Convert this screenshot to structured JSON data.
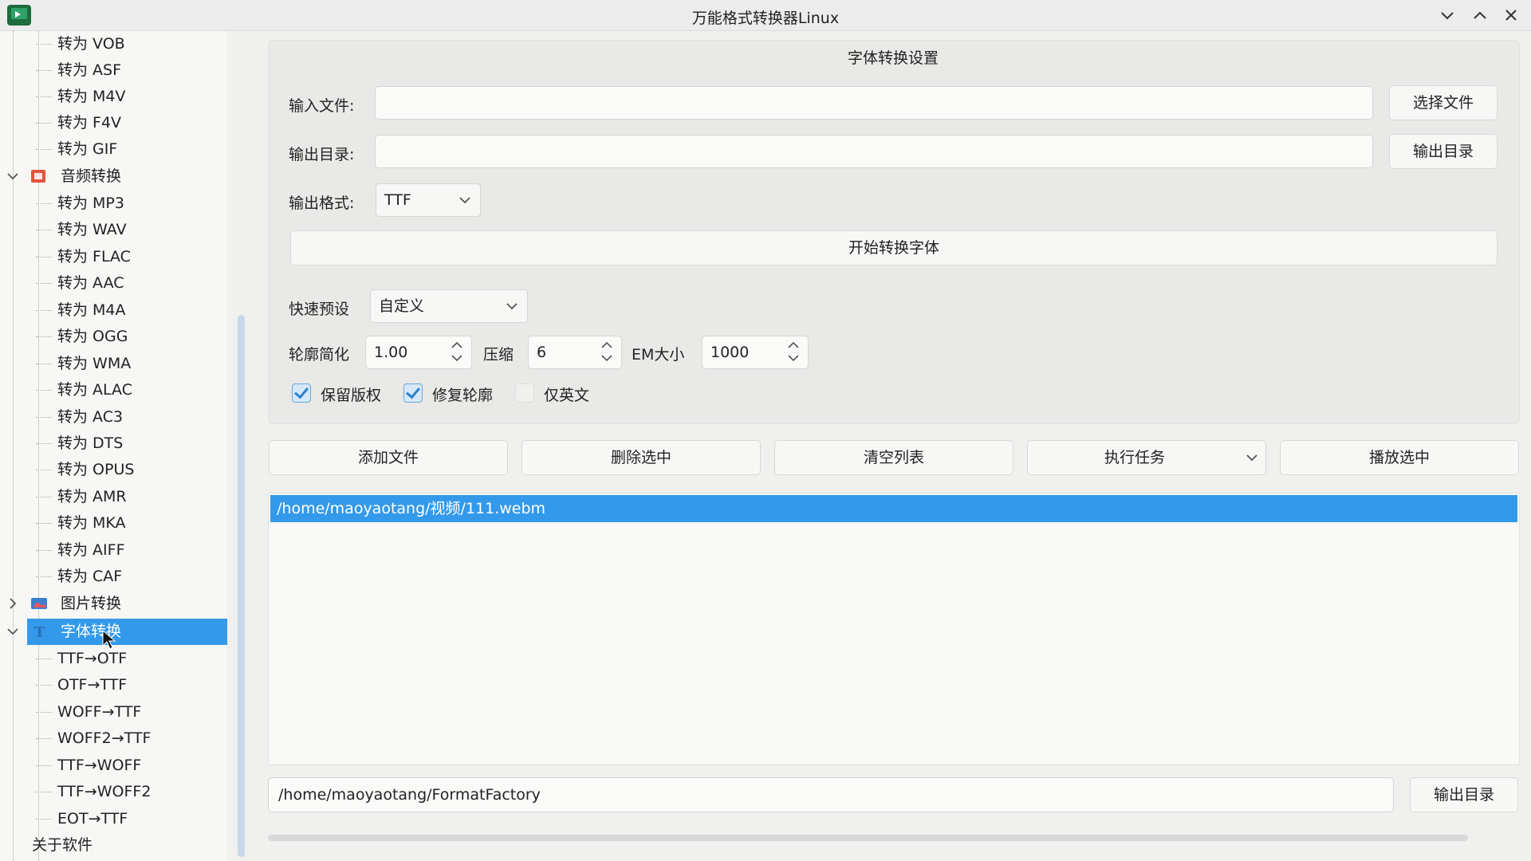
{
  "window": {
    "title": "万能格式转换器Linux"
  },
  "sidebar": {
    "video_children": [
      "转为 VOB",
      "转为 ASF",
      "转为 M4V",
      "转为 F4V",
      "转为 GIF"
    ],
    "audio": {
      "label": "音频转换",
      "children": [
        "转为 MP3",
        "转为 WAV",
        "转为 FLAC",
        "转为 AAC",
        "转为 M4A",
        "转为 OGG",
        "转为 WMA",
        "转为 ALAC",
        "转为 AC3",
        "转为 DTS",
        "转为 OPUS",
        "转为 AMR",
        "转为 MKA",
        "转为 AIFF",
        "转为 CAF"
      ]
    },
    "image": {
      "label": "图片转换"
    },
    "font": {
      "label": "字体转换",
      "children": [
        "TTF→OTF",
        "OTF→TTF",
        "WOFF→TTF",
        "WOFF2→TTF",
        "TTF→WOFF",
        "TTF→WOFF2",
        "EOT→TTF"
      ]
    },
    "about": {
      "label": "关于软件"
    }
  },
  "settings": {
    "title": "字体转换设置",
    "input_label": "输入文件:",
    "input_value": "",
    "choose_file": "选择文件",
    "output_label": "输出目录:",
    "output_value": "",
    "output_dir_button": "输出目录",
    "format_label": "输出格式:",
    "format_value": "TTF",
    "start_button": "开始转换字体",
    "preset_label": "快速预设",
    "preset_value": "自定义",
    "simplify_label": "轮廓简化",
    "simplify_value": "1.00",
    "compress_label": "压缩",
    "compress_value": "6",
    "em_label": "EM大小",
    "em_value": "1000",
    "keep_copyright": {
      "label": "保留版权",
      "checked": true
    },
    "fix_outline": {
      "label": "修复轮廓",
      "checked": true
    },
    "english_only": {
      "label": "仅英文",
      "checked": false
    }
  },
  "toolbar": {
    "add": "添加文件",
    "delete": "删除选中",
    "clear": "清空列表",
    "execute": "执行任务",
    "play": "播放选中"
  },
  "file_list": [
    "/home/maoyaotang/视频/111.webm"
  ],
  "footer": {
    "output_path": "/home/maoyaotang/FormatFactory",
    "output_dir_button": "输出目录"
  }
}
